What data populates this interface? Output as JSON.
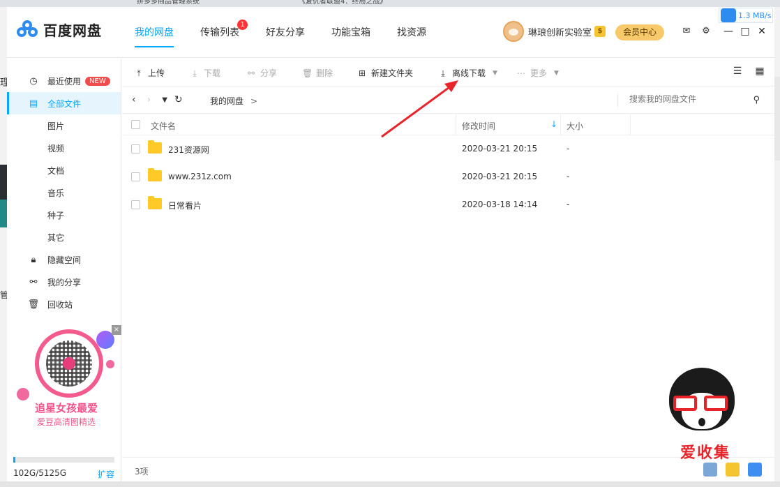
{
  "background": {
    "tabs": [
      "拼多多商品管理系统",
      "《复仇者联盟4：终局之战》"
    ],
    "left_text": "理",
    "left_text2": "管"
  },
  "app": {
    "logo_text": "百度网盘",
    "nav": [
      {
        "label": "我的网盘",
        "active": true
      },
      {
        "label": "传输列表",
        "badge": "1"
      },
      {
        "label": "好友分享"
      },
      {
        "label": "功能宝箱"
      },
      {
        "label": "找资源"
      }
    ],
    "user_name": "琳琅创新实验室",
    "vip_symbol": "$",
    "member_button": "会员中心",
    "speed": "1.3 MB/s"
  },
  "sidebar": {
    "items": [
      {
        "label": "最近使用",
        "icon": "clock-icon",
        "badge": "NEW"
      },
      {
        "label": "全部文件",
        "icon": "file-icon",
        "active": true
      },
      {
        "label": "图片"
      },
      {
        "label": "视频"
      },
      {
        "label": "文档"
      },
      {
        "label": "音乐"
      },
      {
        "label": "种子"
      },
      {
        "label": "其它"
      },
      {
        "label": "隐藏空间",
        "icon": "lock-icon"
      },
      {
        "label": "我的分享",
        "icon": "share-icon"
      },
      {
        "label": "回收站",
        "icon": "trash-icon"
      }
    ],
    "promo": {
      "close": "×",
      "title": "追星女孩最爱",
      "subtitle": "爱豆高清图精选"
    },
    "quota": {
      "text": "102G/5125G",
      "used_fraction": 0.02,
      "expand": "扩容"
    }
  },
  "toolbar": {
    "upload": "上传",
    "download": "下载",
    "share": "分享",
    "delete": "删除",
    "new_folder": "新建文件夹",
    "offline_download": "离线下载",
    "more": "更多"
  },
  "path": {
    "current": "我的网盘",
    "separator": ">",
    "search_placeholder": "搜索我的网盘文件"
  },
  "table": {
    "headers": {
      "name": "文件名",
      "modified": "修改时间",
      "size": "大小"
    },
    "rows": [
      {
        "name": "231资源网",
        "modified": "2020-03-21 20:15",
        "size": "-"
      },
      {
        "name": "www.231z.com",
        "modified": "2020-03-21 20:15",
        "size": "-"
      },
      {
        "name": "日常看片",
        "modified": "2020-03-18 14:14",
        "size": "-"
      }
    ]
  },
  "status": {
    "count": "3项"
  },
  "watermark": {
    "text": "爱收集"
  },
  "colors": {
    "accent": "#06a7ff",
    "folder": "#ffc928",
    "annotation": "#e8242b"
  }
}
